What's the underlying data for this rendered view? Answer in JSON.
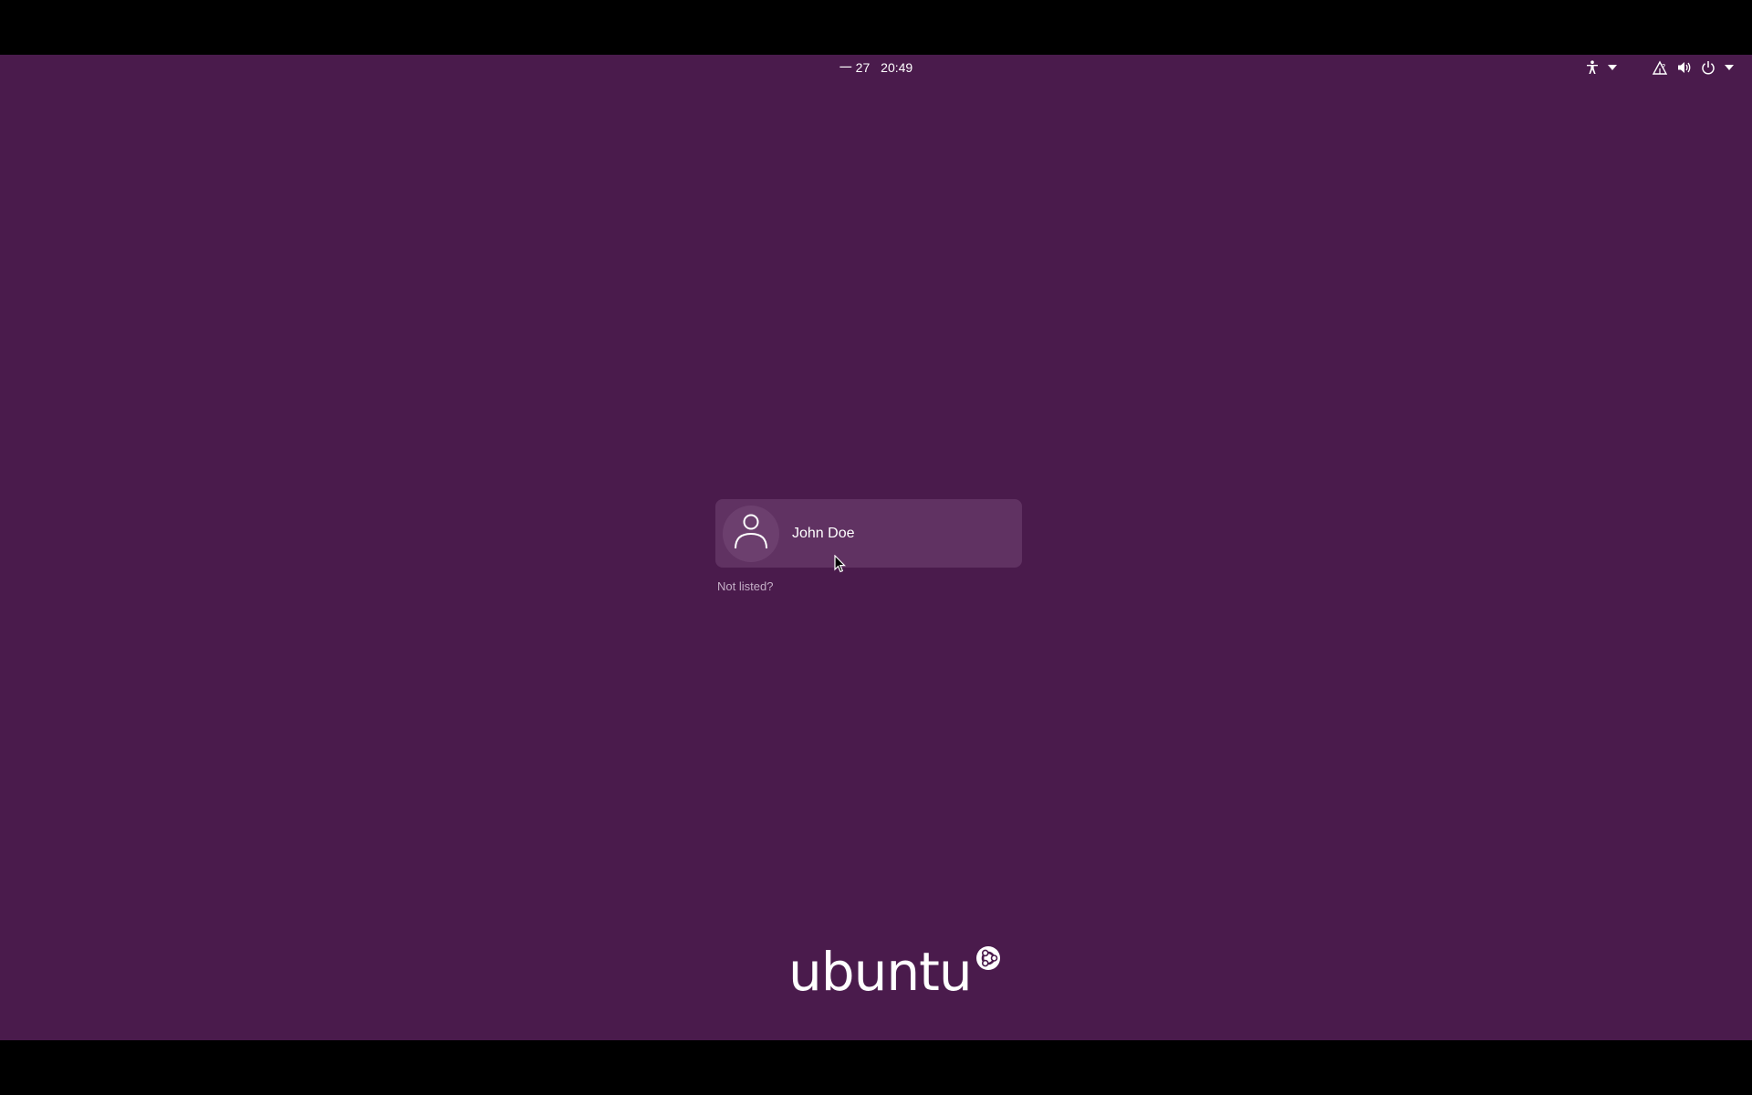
{
  "topbar": {
    "date": "一 27",
    "time": "20:49",
    "icons": [
      "accessibility-icon",
      "chevron-down-icon",
      "network-icon",
      "volume-icon",
      "power-icon",
      "chevron-down-icon"
    ]
  },
  "login": {
    "user_name": "John Doe",
    "avatar_icon": "user-avatar-icon",
    "not_listed_label": "Not listed?"
  },
  "branding": {
    "logo_text": "ubuntu",
    "logo_mark": "circle-of-friends-icon"
  },
  "colors": {
    "background": "#4a1b4c",
    "user_card": "#603262",
    "text": "#ffffff",
    "muted_text": "#c4aec6"
  }
}
